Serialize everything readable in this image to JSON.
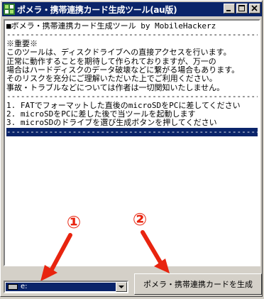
{
  "window": {
    "title": "ポメラ・携帯連携カード生成ツール(au版)",
    "buttons": {
      "minimize": "_",
      "maximize": "□",
      "close": "×"
    }
  },
  "log": {
    "lines": [
      "■ポメラ・携帯連携カード生成ツール by MobileHackerz",
      "-------------------------------------------------------",
      "※重要※",
      "このツールは、ディスクドライブへの直接アクセスを行います。",
      "正常に動作することを期待して作られておりますが、万一の",
      "場合はハードディスクのデータ破壊などに繋がる場合もあります。",
      "そのリスクを充分にご理解いただいた上でご利用ください。",
      "事故・トラブルなどについては作者は一切関知いたしません。",
      "-------------------------------------------------------",
      "1. FATでフォーマットした直後のmicroSDをPCに差してください",
      "2. microSDをPCに差した後で当ツールを起動します",
      "3. microSDのドライブを選び生成ボタンを押してください"
    ],
    "selected_line": "---------------------------------------------------------"
  },
  "annotations": {
    "one": "①",
    "two": "②",
    "color": "#e8240f"
  },
  "drive_select": {
    "value": "e:",
    "icon": "drive-icon"
  },
  "generate_button": {
    "label": "ポメラ・携帯連携カードを生成"
  },
  "colors": {
    "titlebar": "#0a246a",
    "face": "#d4d0c8",
    "selection": "#0a246a"
  }
}
